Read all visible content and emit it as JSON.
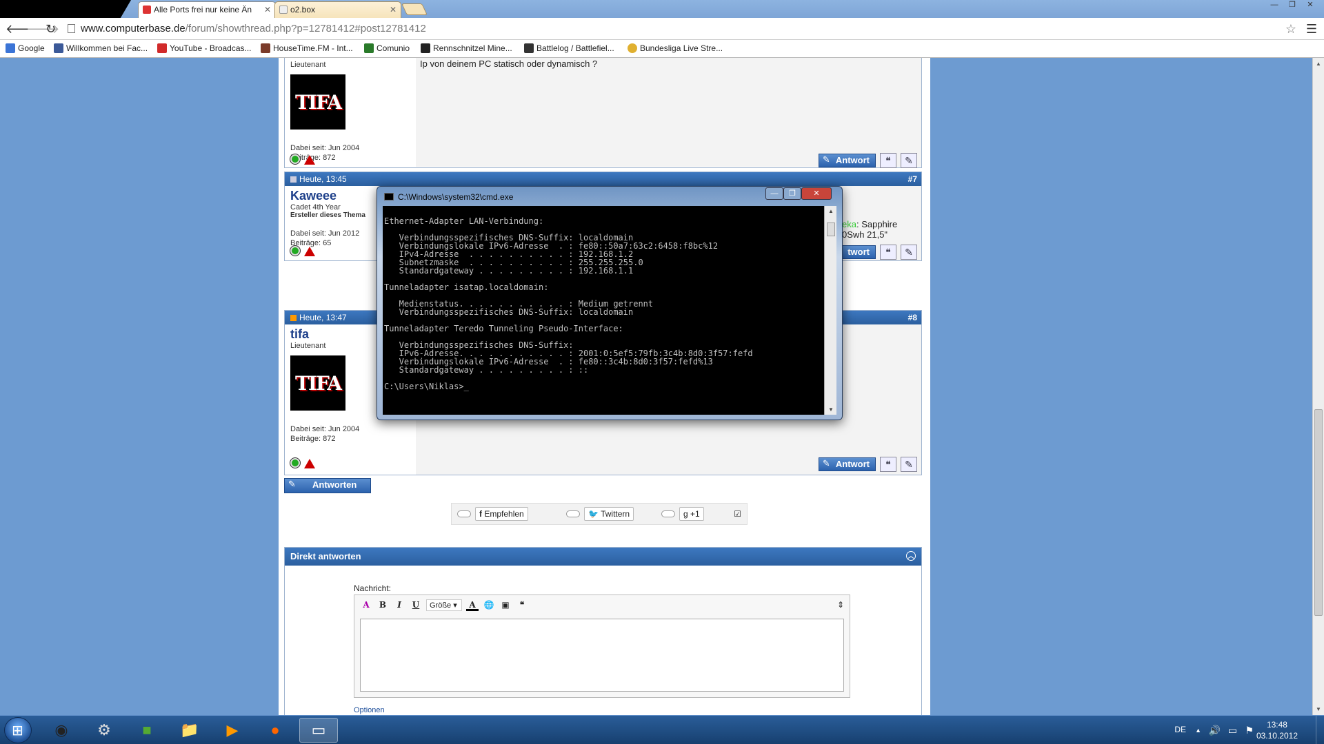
{
  "browser": {
    "tabs": [
      {
        "label": "Alle Ports frei nur keine Än",
        "active": true
      },
      {
        "label": "o2.box",
        "active": false
      }
    ],
    "url": {
      "domain": "www.computerbase.de",
      "path": "/forum/showthread.php?p=12781412#post12781412"
    },
    "bookmarks": [
      {
        "label": "Google",
        "icon": "google-icon",
        "color": "#3b74d6"
      },
      {
        "label": "Willkommen bei Fac...",
        "icon": "facebook-icon",
        "color": "#3b5998"
      },
      {
        "label": "YouTube - Broadcas...",
        "icon": "youtube-icon",
        "color": "#d12a2a"
      },
      {
        "label": "HouseTime.FM - Int...",
        "icon": "housetime-icon",
        "color": "#7a3b2a"
      },
      {
        "label": "Comunio",
        "icon": "comunio-icon",
        "color": "#2a7a2a"
      },
      {
        "label": "Rennschnitzel Mine...",
        "icon": "rennschnitzel-icon",
        "color": "#222222"
      },
      {
        "label": "Battlelog / Battlefiel...",
        "icon": "battlelog-icon",
        "color": "#333333"
      },
      {
        "label": "Bundesliga Live Stre...",
        "icon": "bundesliga-icon",
        "color": "#e0b030"
      }
    ]
  },
  "forum": {
    "post6": {
      "rank": "Lieutenant",
      "avatar_text": "TIFA",
      "since": "Dabei seit: Jun 2004",
      "posts": "Beiträge: 872",
      "message": "Ip von deinem PC statisch oder dynamisch ?",
      "reply_label": "Antwort"
    },
    "post7": {
      "time": "Heute, 13:45",
      "number": "#7",
      "user": "Kaweee",
      "rank": "Cadet 4th Year",
      "extra": "Ersteller dieses Thema",
      "since": "Dabei seit: Jun 2012",
      "posts": "Beiträge: 65",
      "peek_highlight": "eka",
      "peek_line1": ": Sapphire",
      "peek_line2": "0Swh 21,5\"",
      "reply_label": "twort"
    },
    "post8": {
      "time": "Heute, 13:47",
      "number": "#8",
      "user": "tifa",
      "rank": "Lieutenant",
      "avatar_text": "TIFA",
      "since": "Dabei seit: Jun 2004",
      "posts": "Beiträge: 872",
      "reply_label": "Antwort"
    },
    "reply_all_label": "Antworten",
    "social": {
      "recommend": "Empfehlen",
      "twitter": "Twittern",
      "plusone": "+1"
    },
    "direct_reply": {
      "title": "Direkt antworten",
      "message_label": "Nachricht:",
      "size_select": "Größe",
      "options_label": "Optionen"
    }
  },
  "cmd": {
    "title": "C:\\Windows\\system32\\cmd.exe",
    "lines": [
      "",
      "Ethernet-Adapter LAN-Verbindung:",
      "",
      "   Verbindungsspezifisches DNS-Suffix: localdomain",
      "   Verbindungslokale IPv6-Adresse  . : fe80::50a7:63c2:6458:f8bc%12",
      "   IPv4-Adresse  . . . . . . . . . . : 192.168.1.2",
      "   Subnetzmaske  . . . . . . . . . . : 255.255.255.0",
      "   Standardgateway . . . . . . . . . : 192.168.1.1",
      "",
      "Tunneladapter isatap.localdomain:",
      "",
      "   Medienstatus. . . . . . . . . . . : Medium getrennt",
      "   Verbindungsspezifisches DNS-Suffix: localdomain",
      "",
      "Tunneladapter Teredo Tunneling Pseudo-Interface:",
      "",
      "   Verbindungsspezifisches DNS-Suffix:",
      "   IPv6-Adresse. . . . . . . . . . . : 2001:0:5ef5:79fb:3c4b:8d0:3f57:fefd",
      "   Verbindungslokale IPv6-Adresse  . : fe80::3c4b:8d0:3f57:fefd%13",
      "   Standardgateway . . . . . . . . . : ::",
      "",
      "C:\\Users\\Niklas>_"
    ]
  },
  "taskbar": {
    "apps": [
      "chrome-icon",
      "steam-icon",
      "minecraft-icon",
      "explorer-icon",
      "media-player-icon",
      "origin-icon",
      "cmd-icon"
    ],
    "language": "DE",
    "time": "13:48",
    "date": "03.10.2012"
  }
}
